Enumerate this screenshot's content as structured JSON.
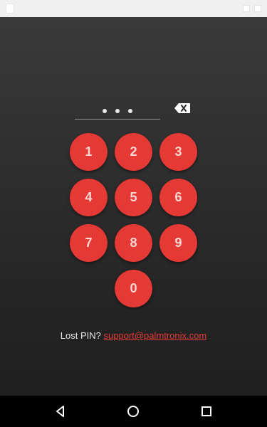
{
  "colors": {
    "accent": "#e53935",
    "background_top": "#3a3a3a",
    "background_bottom": "#1f1f1f",
    "text": "#e6e6e6",
    "key_text": "#ffd7d3",
    "nav_bar": "#000000"
  },
  "pin": {
    "entered_count": 3,
    "dots": [
      "•",
      "•",
      "•"
    ],
    "backspace_icon": "backspace-icon"
  },
  "keypad": {
    "keys": [
      "1",
      "2",
      "3",
      "4",
      "5",
      "6",
      "7",
      "8",
      "9",
      "0"
    ]
  },
  "help": {
    "prefix": "Lost PIN?",
    "email": "support@palmtronix.com"
  },
  "navigation": {
    "back_icon": "back-triangle-icon",
    "home_icon": "home-circle-icon",
    "recent_icon": "recent-square-icon"
  }
}
